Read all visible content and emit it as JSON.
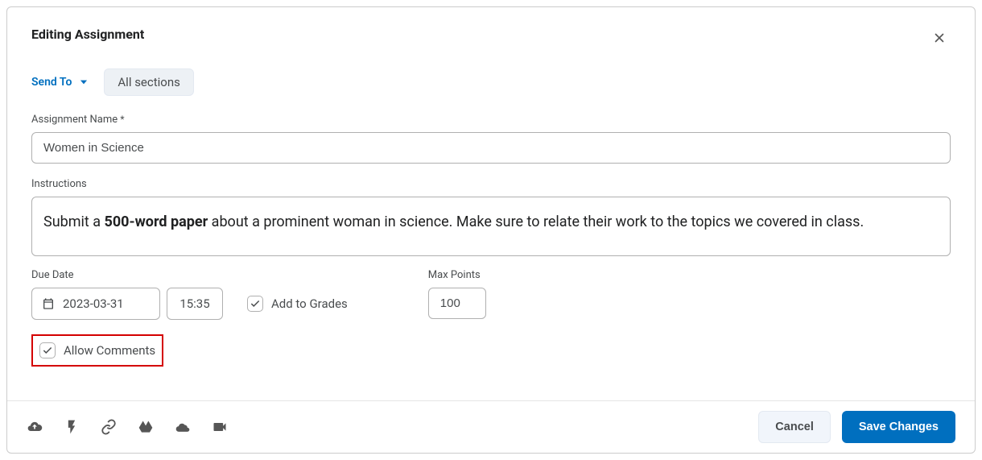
{
  "header": {
    "title": "Editing Assignment"
  },
  "sendTo": {
    "label": "Send To",
    "chip": "All sections"
  },
  "form": {
    "assignmentName": {
      "label": "Assignment Name",
      "requiredMark": "*",
      "value": "Women in Science"
    },
    "instructions": {
      "label": "Instructions",
      "text_prefix": "Submit a ",
      "text_bold": "500-word paper",
      "text_suffix": " about a prominent woman in science. Make sure to relate their work to the topics we covered in class."
    },
    "dueDate": {
      "label": "Due Date",
      "date": "2023-03-31",
      "time": "15:35"
    },
    "addToGrades": {
      "label": "Add to Grades",
      "checked": true
    },
    "maxPoints": {
      "label": "Max Points",
      "value": "100"
    },
    "allowComments": {
      "label": "Allow Comments",
      "checked": true
    }
  },
  "footer": {
    "cancel": "Cancel",
    "save": "Save Changes"
  },
  "icons": {
    "upload": "cloud-upload",
    "flash": "lightning",
    "link": "link",
    "gdrive": "google-drive",
    "onedrive": "onedrive",
    "video": "video-camera"
  }
}
